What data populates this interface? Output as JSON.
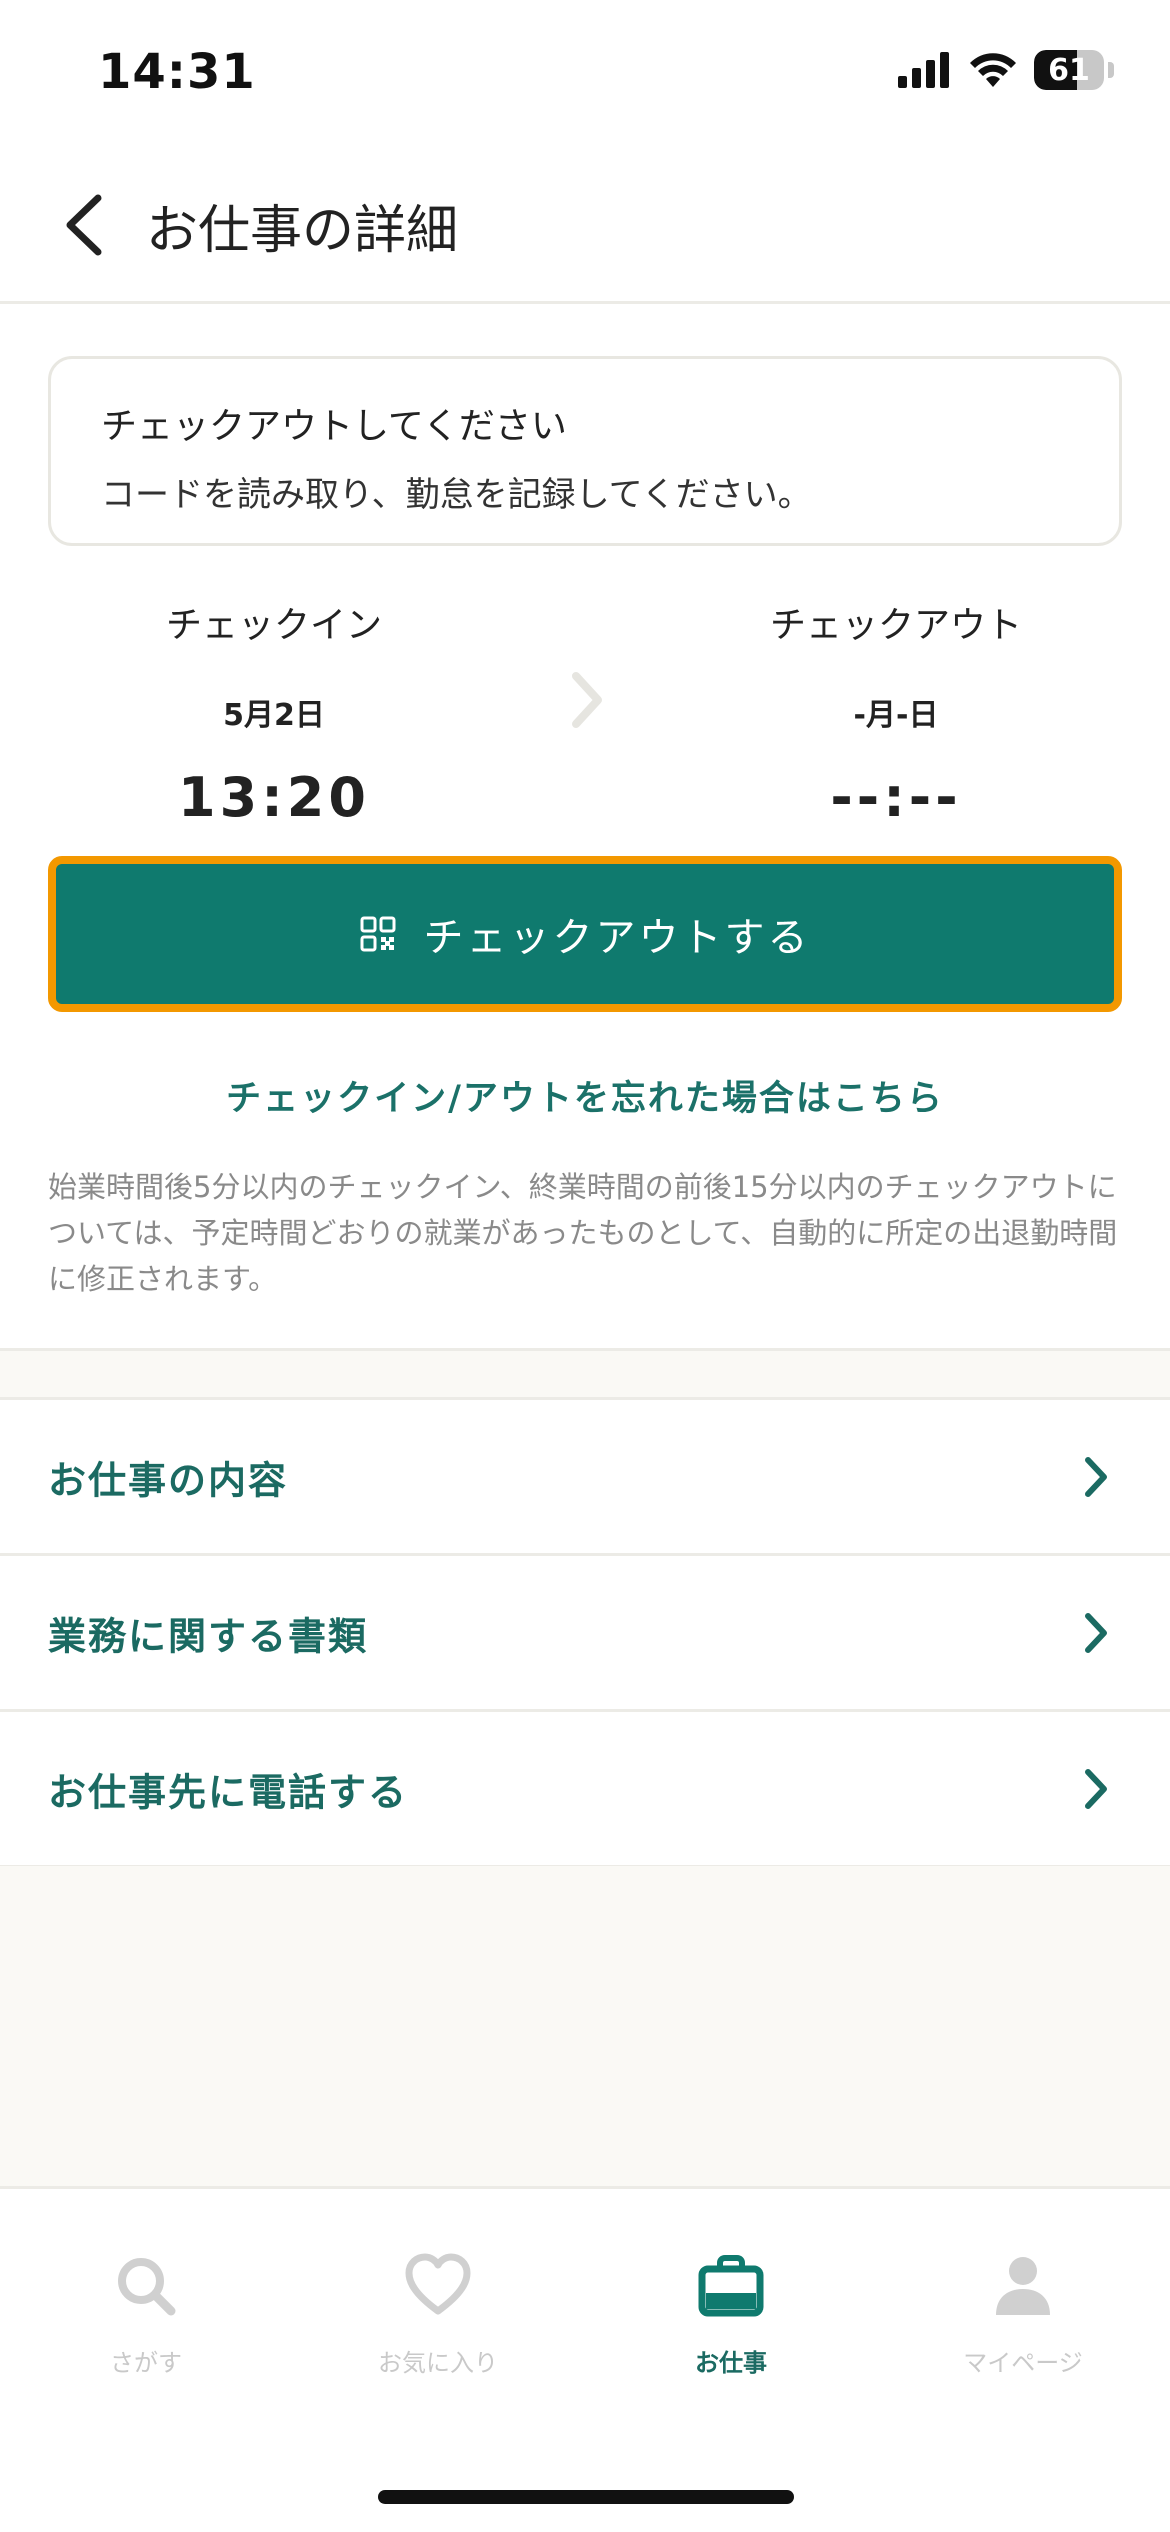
{
  "status_bar": {
    "time": "14:31",
    "battery_level": "61",
    "battery_fraction": 0.61
  },
  "nav": {
    "title": "お仕事の詳細"
  },
  "info_card": {
    "title": "チェックアウトしてください",
    "description": "コードを読み取り、勤怠を記録してください。"
  },
  "checkin": {
    "label": "チェックイン",
    "date": "5月2日",
    "time": "13:20"
  },
  "checkout": {
    "label": "チェックアウト",
    "date": "-月-日",
    "time": "--:--"
  },
  "checkout_button": {
    "label": "チェックアウトする"
  },
  "forgot_link": "チェックイン/アウトを忘れた場合はこちら",
  "note": "始業時間後5分以内のチェックイン、終業時間の前後15分以内のチェックアウトについては、予定時間どおりの就業があったものとして、自動的に所定の出退勤時間に修正されます。",
  "list": [
    {
      "label": "お仕事の内容"
    },
    {
      "label": "業務に関する書類"
    },
    {
      "label": "お仕事先に電話する"
    }
  ],
  "tabs": [
    {
      "label": "さがす",
      "icon": "search-icon"
    },
    {
      "label": "お気に入り",
      "icon": "heart-icon"
    },
    {
      "label": "お仕事",
      "icon": "briefcase-icon",
      "active": true
    },
    {
      "label": "マイページ",
      "icon": "person-icon"
    }
  ],
  "colors": {
    "primary": "#0f7a6e",
    "highlight": "#f39800",
    "accent_text": "#1b6a62"
  }
}
